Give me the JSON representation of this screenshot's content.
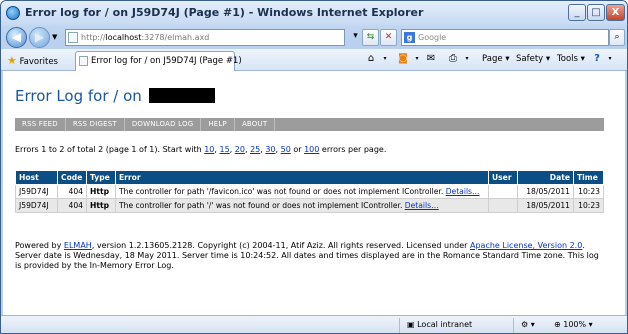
{
  "window": {
    "title": "Error log for / on J59D74J (Page #1) - Windows Internet Explorer",
    "minimize": "_",
    "maximize": "□",
    "close": "X"
  },
  "address": {
    "prefix": "http://",
    "host": "localhost",
    "rest": ":3278/elmah.axd"
  },
  "search": {
    "placeholder": "Google"
  },
  "toolbar": {
    "favorites": "Favorites",
    "tab_title": "Error log for / on J59D74J (Page #1)",
    "page": "Page",
    "safety": "Safety",
    "tools": "Tools"
  },
  "page": {
    "heading": "Error Log for / on",
    "menu": [
      "RSS FEED",
      "RSS DIGEST",
      "DOWNLOAD LOG",
      "HELP",
      "ABOUT"
    ],
    "summary": {
      "pre": "Errors 1 to 2 of total 2 (page 1 of 1). Start with",
      "sizes": [
        "10",
        "15",
        "20",
        "25",
        "30",
        "50"
      ],
      "or": "or",
      "last": "100",
      "post": "errors per page."
    },
    "table": {
      "headers": [
        "Host",
        "Code",
        "Type",
        "Error",
        "User",
        "Date",
        "Time"
      ],
      "rows": [
        {
          "host": "J59D74J",
          "code": "404",
          "type": "Http",
          "error": "The controller for path '/favicon.ico' was not found or does not implement IController.",
          "details": "Details…",
          "user": "",
          "date": "18/05/2011",
          "time": "10:23"
        },
        {
          "host": "J59D74J",
          "code": "404",
          "type": "Http",
          "error": "The controller for path '/' was not found or does not implement IController.",
          "details": "Details…",
          "user": "",
          "date": "18/05/2011",
          "time": "10:23"
        }
      ]
    },
    "footer": {
      "p1": "Powered by",
      "elmah": "ELMAH",
      "p2": ", version 1.2.13605.2128. Copyright (c) 2004-11, Atif Aziz. All rights reserved. Licensed under",
      "license": "Apache License, Version 2.0",
      "p3": ". Server date is Wednesday, 18 May 2011. Server time is 10:24:52. All dates and times displayed are in the Romance Standard Time zone. This log is provided by the In-Memory Error Log."
    }
  },
  "status": {
    "zone": "Local intranet",
    "zoom": "100%"
  }
}
